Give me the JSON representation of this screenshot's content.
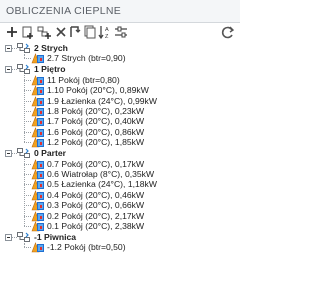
{
  "header": {
    "title": "OBLICZENIA CIEPLNE"
  },
  "toolbar": {
    "buttons": [
      {
        "icon": "add-icon"
      },
      {
        "icon": "add-room-icon"
      },
      {
        "icon": "add-group-icon"
      },
      {
        "icon": "delete-icon"
      },
      {
        "icon": "cut-icon"
      },
      {
        "icon": "copy-icon"
      },
      {
        "icon": "sort-icon"
      },
      {
        "icon": "settings-icon"
      },
      {
        "icon": "refresh-icon"
      }
    ]
  },
  "tree": {
    "groups": [
      {
        "label": "2 Strych",
        "rooms": [
          "2.7 Strych (btr=0,90)"
        ]
      },
      {
        "label": "1 Piętro",
        "rooms": [
          "11 Pokój (btr=0,80)",
          "1.10 Pokój (20°C), 0,89kW",
          "1.9 Łazienka (24°C), 0,99kW",
          "1.8 Pokój (20°C), 0,23kW",
          "1.7 Pokój (20°C), 0,40kW",
          "1.6 Pokój (20°C), 0,86kW",
          "1.2 Pokój (20°C), 1,85kW"
        ]
      },
      {
        "label": "0 Parter",
        "rooms": [
          "0.7 Pokój (20°C), 0,17kW",
          "0.6 Wiatrołap (8°C), 0,35kW",
          "0.5 Łazienka (24°C), 1,18kW",
          "0.4 Pokój (20°C), 0,46kW",
          "0.3 Pokój (20°C), 0,66kW",
          "0.2 Pokój (20°C), 2,17kW",
          "0.1 Pokój (20°C), 2,38kW"
        ]
      },
      {
        "label": "-1 Piwnica",
        "rooms": [
          "-1.2 Pokój (btr=0,50)"
        ]
      }
    ]
  }
}
